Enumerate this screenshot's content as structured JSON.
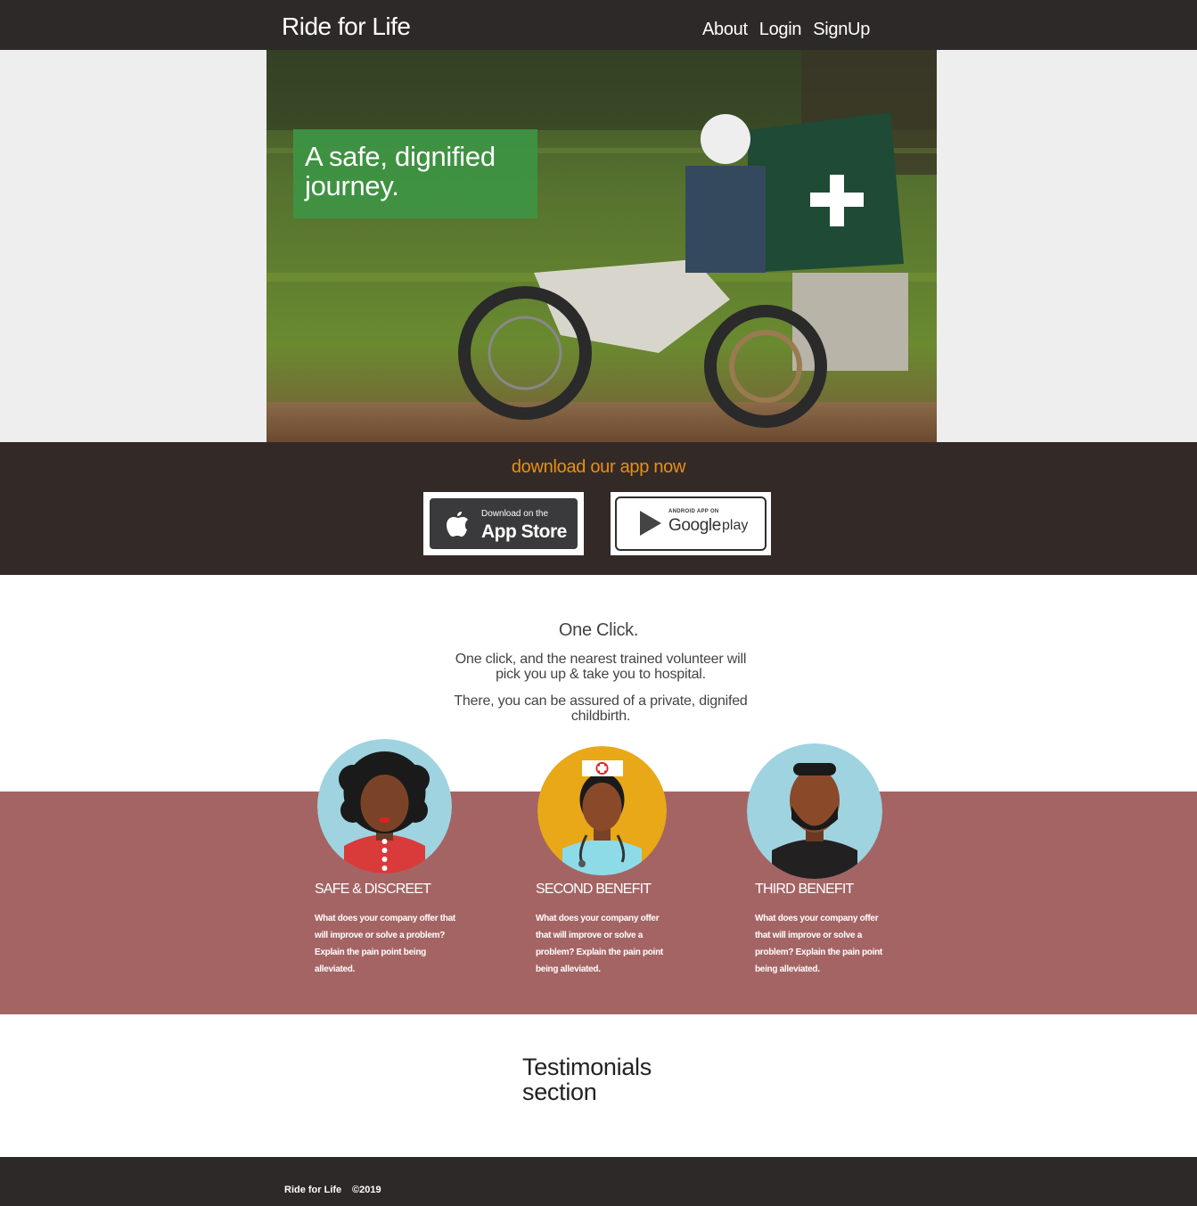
{
  "header": {
    "brand": "Ride for Life",
    "nav": [
      {
        "label": "About"
      },
      {
        "label": "Login"
      },
      {
        "label": "SignUp"
      }
    ]
  },
  "hero": {
    "caption": "A safe, dignified journey.",
    "image": "motorcycle-ambulance-photo"
  },
  "download": {
    "title": "download our app now",
    "title_color": "#e98f12",
    "apple": {
      "small": "Download on the",
      "big": "App Store",
      "icon": "apple-icon"
    },
    "google": {
      "small": "ANDROID APP ON",
      "big": "Google",
      "play": "play",
      "icon": "play-triangle-icon"
    }
  },
  "intro": {
    "title": "One Click.",
    "p1": "One click, and the nearest trained volunteer will pick you up & take you to hospital.",
    "p2": "There, you can be assured of a private, dignifed childbirth."
  },
  "features": [
    {
      "title": "SAFE & DISCREET",
      "text": "What does your company offer that will improve or solve a problem? Explain the pain point being alleviated.",
      "icon": "woman-avatar-icon"
    },
    {
      "title": "SECOND BENEFIT",
      "text": "What does your company offer that will improve or solve a problem? Explain the pain point being alleviated.",
      "icon": "nurse-avatar-icon"
    },
    {
      "title": "THIRD BENEFIT",
      "text": "What does your company offer that will improve or solve a problem? Explain the pain point being alleviated.",
      "icon": "man-avatar-icon"
    }
  ],
  "testimonials": {
    "title": "Testimonials section"
  },
  "footer": {
    "brand": "Ride for Life",
    "copyright": "©2019"
  },
  "colors": {
    "dark": "#2d2928",
    "band": "#332a28",
    "features_bg": "#a56464",
    "hero_caption": "#3c9646"
  }
}
